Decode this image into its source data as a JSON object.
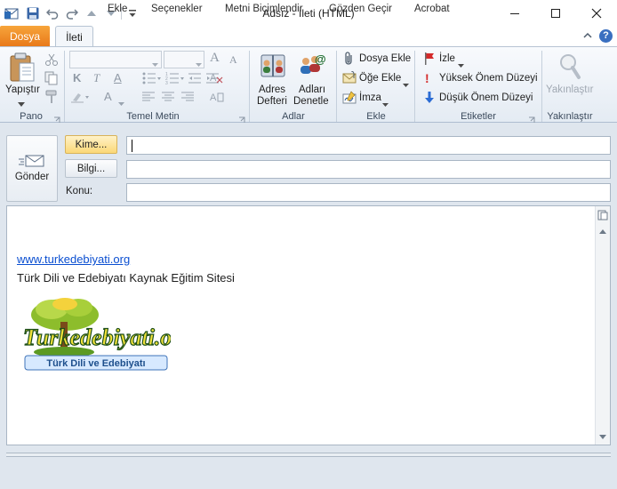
{
  "window": {
    "title": "Adsız  -  İleti (HTML)"
  },
  "tabs": {
    "file": "Dosya",
    "items": [
      "İleti",
      "Ekle",
      "Seçenekler",
      "Metni Biçimlendir",
      "Gözden Geçir",
      "Acrobat"
    ]
  },
  "ribbon": {
    "pano": {
      "label": "Pano",
      "paste": "Yapıştır"
    },
    "temel_metin": {
      "label": "Temel Metin"
    },
    "adlar": {
      "label": "Adlar",
      "adres_line1": "Adres",
      "adres_line2": "Defteri",
      "denetle_line1": "Adları",
      "denetle_line2": "Denetle"
    },
    "ekle": {
      "label": "Ekle",
      "dosya": "Dosya Ekle",
      "oge": "Öğe Ekle",
      "imza": "İmza"
    },
    "etiketler": {
      "label": "Etiketler",
      "izle": "İzle",
      "yuksek": "Yüksek Önem Düzeyi",
      "dusuk": "Düşük Önem Düzeyi"
    },
    "yakinlastir": {
      "label": "Yakınlaştır",
      "button": "Yakınlaştır"
    }
  },
  "compose": {
    "send": "Gönder",
    "to_button": "Kime...",
    "cc_button": "Bilgi...",
    "subject_label": "Konu:",
    "to_value": "",
    "cc_value": "",
    "subject_value": ""
  },
  "body": {
    "link": "www.turkedebiyati.org",
    "tagline": "Türk Dili ve Edebiyatı Kaynak Eğitim Sitesi",
    "logo_text": "Turkedebiyati.org",
    "logo_subtext": "Türk Dili ve Edebiyatı"
  },
  "colors": {
    "file_tab": "#e8791a",
    "link": "#0b4fd1",
    "accent": "#2b5797"
  }
}
